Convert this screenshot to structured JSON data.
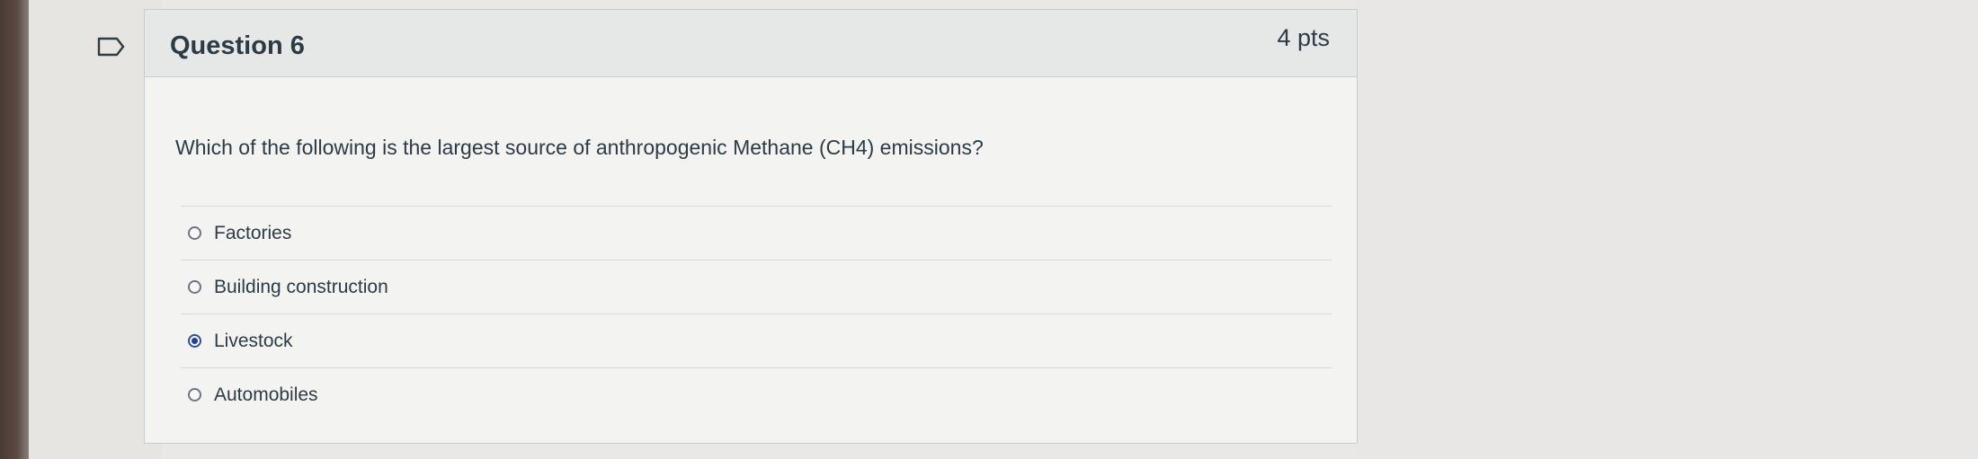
{
  "question": {
    "title": "Question 6",
    "points": "4 pts",
    "text": "Which of the following is the largest source of anthropogenic Methane (CH4) emissions?",
    "answers": [
      {
        "label": "Factories",
        "selected": false
      },
      {
        "label": "Building construction",
        "selected": false
      },
      {
        "label": "Livestock",
        "selected": true
      },
      {
        "label": "Automobiles",
        "selected": false
      }
    ]
  },
  "icons": {
    "flag": "flag-icon",
    "radio": "radio-button"
  },
  "colors": {
    "selected_radio": "#1f3f9a",
    "text": "#2d3b45",
    "header_bg": "#e6e7e7"
  }
}
